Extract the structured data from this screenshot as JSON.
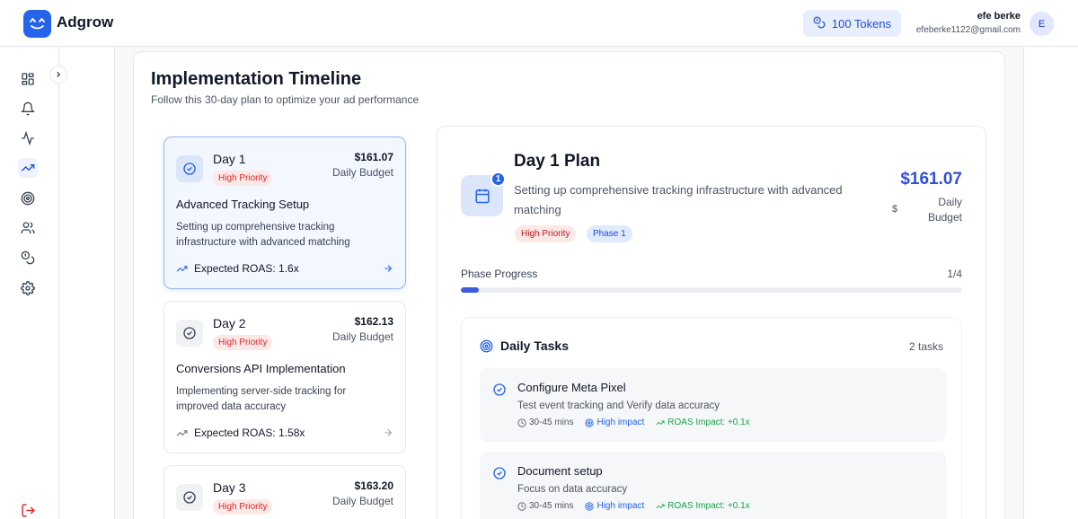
{
  "app": {
    "brand": "Adgrow",
    "tokens_label": "100 Tokens",
    "user_name": "efe berke",
    "user_email": "efeberke1122@gmail.com",
    "avatar_initial": "E"
  },
  "sidebar": {
    "items": [
      {
        "icon": "grid-icon"
      },
      {
        "icon": "bell-icon"
      },
      {
        "icon": "activity-icon"
      },
      {
        "icon": "trending-up-icon",
        "active": true
      },
      {
        "icon": "target-icon"
      },
      {
        "icon": "users-icon"
      },
      {
        "icon": "coins-icon"
      },
      {
        "icon": "settings-icon"
      }
    ],
    "logout_icon": "logout-icon"
  },
  "timeline": {
    "title": "Implementation Timeline",
    "subtitle": "Follow this 30-day plan to optimize your ad performance",
    "days": [
      {
        "day": "Day 1",
        "priority": "High Priority",
        "amount": "$161.07",
        "budget_label": "Daily Budget",
        "title": "Advanced Tracking Setup",
        "desc": "Setting up comprehensive tracking infrastructure with advanced matching",
        "roas": "Expected ROAS: 1.6x",
        "selected": true
      },
      {
        "day": "Day 2",
        "priority": "High Priority",
        "amount": "$162.13",
        "budget_label": "Daily Budget",
        "title": "Conversions API Implementation",
        "desc": "Implementing server-side tracking for improved data accuracy",
        "roas": "Expected ROAS: 1.58x",
        "selected": false
      },
      {
        "day": "Day 3",
        "priority": "High Priority",
        "amount": "$163.20",
        "budget_label": "Daily Budget",
        "selected": false
      }
    ]
  },
  "plan": {
    "badge_number": "1",
    "title": "Day 1 Plan",
    "desc": "Setting up comprehensive tracking infrastructure with advanced matching",
    "priority_badge": "High Priority",
    "phase_badge": "Phase 1",
    "amount": "$161.07",
    "dollar_glyph": "$",
    "budget_label": "Daily Budget",
    "progress_label": "Phase Progress",
    "progress_count": "1/4",
    "progress_fraction": 0.035
  },
  "tasks": {
    "title": "Daily Tasks",
    "count": "2 tasks",
    "items": [
      {
        "title": "Configure Meta Pixel",
        "desc": "Test event tracking and Verify data accuracy",
        "time": "30-45 mins",
        "impact": "High impact",
        "roas": "ROAS Impact: +0.1x"
      },
      {
        "title": "Document setup",
        "desc": "Focus on data accuracy",
        "time": "30-45 mins",
        "impact": "High impact",
        "roas": "ROAS Impact: +0.1x"
      }
    ]
  },
  "colors": {
    "accent": "#2563eb",
    "priority_red": "#dc2626",
    "roas_green": "#16a34a"
  }
}
